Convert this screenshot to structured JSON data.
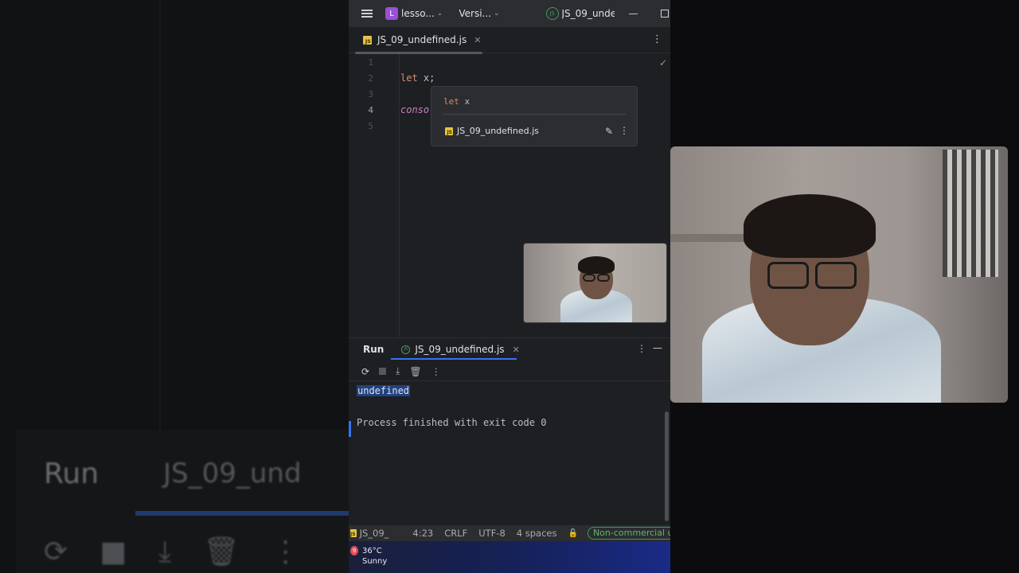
{
  "titlebar": {
    "project_badge": "L",
    "project_name": "lesso...",
    "vcs_label": "Versi...",
    "run_config": "JS_09_unde"
  },
  "editor_tab": {
    "label": "JS_09_undefined.js",
    "icon_text": "JS"
  },
  "editor": {
    "line_numbers": [
      "1",
      "2",
      "3",
      "4",
      "5"
    ],
    "active_line": "4",
    "line2_keyword": "let",
    "line2_ident": " x;",
    "line4_text": "conso"
  },
  "popup": {
    "decl_keyword": "let",
    "decl_var": " x",
    "file": "JS_09_undefined.js"
  },
  "run_panel": {
    "title": "Run",
    "tab_label": "JS_09_undefined.js",
    "output_line1": "undefined",
    "output_line2": "Process finished with exit code 0"
  },
  "statusbar": {
    "path": "JS_09_",
    "position": "4:23",
    "line_ending": "CRLF",
    "encoding": "UTF-8",
    "indent": "4 spaces",
    "license": "Non-commercial u"
  },
  "taskbar": {
    "weather_badge": "9",
    "temperature": "36°C",
    "condition": "Sunny"
  },
  "background": {
    "run_label": "Run",
    "file_label": "JS_09_und"
  },
  "colors": {
    "accent": "#3574f0",
    "keyword": "#cf8e6d",
    "selection": "#214283",
    "success": "#5fb865"
  }
}
